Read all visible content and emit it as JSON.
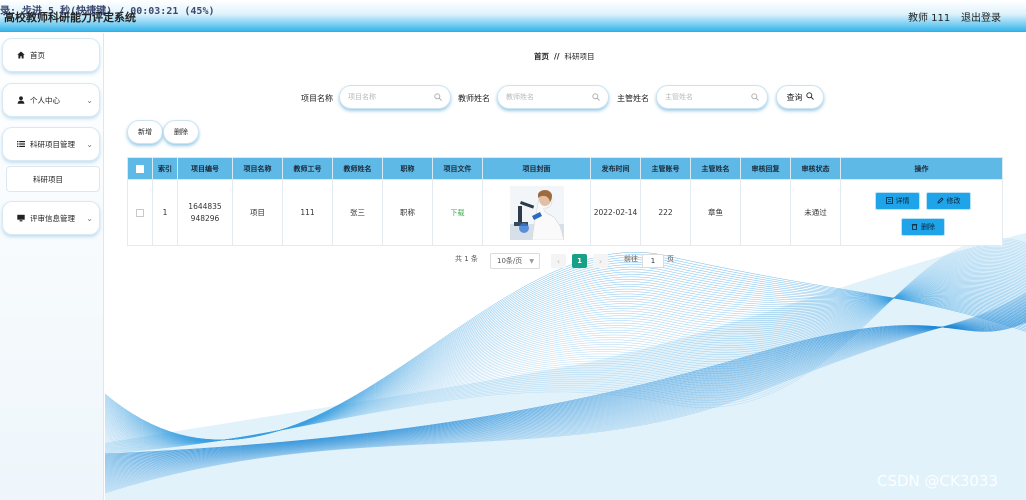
{
  "header": {
    "title": "高校教师科研能力评定系统",
    "overlay": "录: 步进 5 秒(快捷键) / 00:03:21 (45%)",
    "user_label": "教师 111",
    "logout": "退出登录"
  },
  "sidebar": {
    "items": [
      {
        "label": "首页",
        "icon": "home-icon"
      },
      {
        "label": "个人中心",
        "icon": "user-icon"
      },
      {
        "label": "科研项目管理",
        "icon": "list-icon"
      },
      {
        "label": "评审信息管理",
        "icon": "monitor-icon"
      }
    ],
    "sub_items": [
      {
        "label": "科研项目"
      }
    ]
  },
  "breadcrumb": {
    "home": "首页",
    "separator": "//",
    "current": "科研项目"
  },
  "search": {
    "project_name_label": "项目名称",
    "project_name_placeholder": "项目名称",
    "teacher_name_label": "教师姓名",
    "teacher_name_placeholder": "教师姓名",
    "supervisor_name_label": "主管姓名",
    "supervisor_name_placeholder": "主管姓名",
    "search_button": "查询"
  },
  "actions": {
    "add": "新增",
    "delete": "删除"
  },
  "table": {
    "headers": [
      "索引",
      "项目编号",
      "项目名称",
      "教师工号",
      "教师姓名",
      "职称",
      "项目文件",
      "项目封面",
      "发布时间",
      "主管账号",
      "主管姓名",
      "审核回复",
      "审核状态",
      "操作"
    ],
    "rows": [
      {
        "index": "1",
        "project_no": "1644835948296",
        "project_name": "项目",
        "teacher_no": "111",
        "teacher_name": "张三",
        "title": "职称",
        "file_link": "下载",
        "publish_time": "2022-02-14",
        "supervisor_account": "222",
        "supervisor_name": "章鱼",
        "review_reply": "",
        "review_status": "未通过",
        "ops": {
          "detail": "详情",
          "edit": "修改",
          "delete": "删除"
        }
      }
    ]
  },
  "pagination": {
    "total": "共 1 条",
    "page_size": "10条/页",
    "current_page": "1",
    "goto_label": "前往",
    "goto_value": "1",
    "page_unit": "页"
  },
  "watermark": "CSDN @CK3033",
  "colors": {
    "header_accent": "#39b6ec",
    "table_header": "#5fb9e7",
    "op_button": "#1fa4ea",
    "active_page": "#16a085",
    "wave": "#3b9fe0"
  }
}
